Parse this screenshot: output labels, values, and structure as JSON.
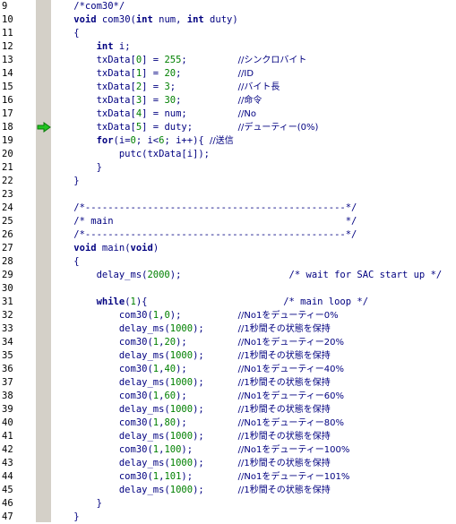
{
  "editor": {
    "current_line": 18,
    "lines": [
      {
        "n": 9,
        "seg": [
          {
            "t": "    /*com30*/",
            "c": "cm"
          }
        ]
      },
      {
        "n": 10,
        "seg": [
          {
            "t": "    ",
            "c": "pl"
          },
          {
            "t": "void",
            "c": "kw"
          },
          {
            "t": " com30(",
            "c": "pl"
          },
          {
            "t": "int",
            "c": "kw"
          },
          {
            "t": " num, ",
            "c": "pl"
          },
          {
            "t": "int",
            "c": "kw"
          },
          {
            "t": " duty)",
            "c": "pl"
          }
        ]
      },
      {
        "n": 11,
        "seg": [
          {
            "t": "    {",
            "c": "pl"
          }
        ]
      },
      {
        "n": 12,
        "seg": [
          {
            "t": "        ",
            "c": "pl"
          },
          {
            "t": "int",
            "c": "kw"
          },
          {
            "t": " i;",
            "c": "pl"
          }
        ]
      },
      {
        "n": 13,
        "seg": [
          {
            "t": "        txData[",
            "c": "pl"
          },
          {
            "t": "0",
            "c": "nm"
          },
          {
            "t": "] = ",
            "c": "pl"
          },
          {
            "t": "255",
            "c": "nm"
          },
          {
            "t": ";         ",
            "c": "pl"
          },
          {
            "t": "//シンクロバイト",
            "c": "cm jp"
          }
        ]
      },
      {
        "n": 14,
        "seg": [
          {
            "t": "        txData[",
            "c": "pl"
          },
          {
            "t": "1",
            "c": "nm"
          },
          {
            "t": "] = ",
            "c": "pl"
          },
          {
            "t": "20",
            "c": "nm"
          },
          {
            "t": ";          ",
            "c": "pl"
          },
          {
            "t": "//ID",
            "c": "cm jp"
          }
        ]
      },
      {
        "n": 15,
        "seg": [
          {
            "t": "        txData[",
            "c": "pl"
          },
          {
            "t": "2",
            "c": "nm"
          },
          {
            "t": "] = ",
            "c": "pl"
          },
          {
            "t": "3",
            "c": "nm"
          },
          {
            "t": ";           ",
            "c": "pl"
          },
          {
            "t": "//バイト長",
            "c": "cm jp"
          }
        ]
      },
      {
        "n": 16,
        "seg": [
          {
            "t": "        txData[",
            "c": "pl"
          },
          {
            "t": "3",
            "c": "nm"
          },
          {
            "t": "] = ",
            "c": "pl"
          },
          {
            "t": "30",
            "c": "nm"
          },
          {
            "t": ";          ",
            "c": "pl"
          },
          {
            "t": "//命令",
            "c": "cm jp"
          }
        ]
      },
      {
        "n": 17,
        "seg": [
          {
            "t": "        txData[",
            "c": "pl"
          },
          {
            "t": "4",
            "c": "nm"
          },
          {
            "t": "] = num;         ",
            "c": "pl"
          },
          {
            "t": "//No",
            "c": "cm jp"
          }
        ]
      },
      {
        "n": 18,
        "seg": [
          {
            "t": "        txData[",
            "c": "pl"
          },
          {
            "t": "5",
            "c": "nm"
          },
          {
            "t": "] = duty;        ",
            "c": "pl"
          },
          {
            "t": "//デューティー(0%)",
            "c": "cm jp"
          }
        ]
      },
      {
        "n": 19,
        "seg": [
          {
            "t": "        ",
            "c": "pl"
          },
          {
            "t": "for",
            "c": "kw"
          },
          {
            "t": "(i=",
            "c": "pl"
          },
          {
            "t": "0",
            "c": "nm"
          },
          {
            "t": "; i<",
            "c": "pl"
          },
          {
            "t": "6",
            "c": "nm"
          },
          {
            "t": "; i++){ ",
            "c": "pl"
          },
          {
            "t": "//送信",
            "c": "cm jp"
          }
        ]
      },
      {
        "n": 20,
        "seg": [
          {
            "t": "            putc(txData[i]);",
            "c": "pl"
          }
        ]
      },
      {
        "n": 21,
        "seg": [
          {
            "t": "        }",
            "c": "pl"
          }
        ]
      },
      {
        "n": 22,
        "seg": [
          {
            "t": "    }",
            "c": "pl"
          }
        ]
      },
      {
        "n": 23,
        "seg": [
          {
            "t": "",
            "c": "pl"
          }
        ]
      },
      {
        "n": 24,
        "seg": [
          {
            "t": "    /*----------------------------------------------*/",
            "c": "cm"
          }
        ]
      },
      {
        "n": 25,
        "seg": [
          {
            "t": "    /* main                                         */",
            "c": "cm"
          }
        ]
      },
      {
        "n": 26,
        "seg": [
          {
            "t": "    /*----------------------------------------------*/",
            "c": "cm"
          }
        ]
      },
      {
        "n": 27,
        "seg": [
          {
            "t": "    ",
            "c": "pl"
          },
          {
            "t": "void",
            "c": "kw"
          },
          {
            "t": " main(",
            "c": "pl"
          },
          {
            "t": "void",
            "c": "kw"
          },
          {
            "t": ")",
            "c": "pl"
          }
        ]
      },
      {
        "n": 28,
        "seg": [
          {
            "t": "    {",
            "c": "pl"
          }
        ]
      },
      {
        "n": 29,
        "seg": [
          {
            "t": "        delay_ms(",
            "c": "pl"
          },
          {
            "t": "2000",
            "c": "nm"
          },
          {
            "t": ");                   ",
            "c": "pl"
          },
          {
            "t": "/* wait for SAC start up */",
            "c": "cm"
          }
        ]
      },
      {
        "n": 30,
        "seg": [
          {
            "t": "",
            "c": "pl"
          }
        ]
      },
      {
        "n": 31,
        "seg": [
          {
            "t": "        ",
            "c": "pl"
          },
          {
            "t": "while",
            "c": "kw"
          },
          {
            "t": "(",
            "c": "pl"
          },
          {
            "t": "1",
            "c": "nm"
          },
          {
            "t": "){                        ",
            "c": "pl"
          },
          {
            "t": "/* main loop */",
            "c": "cm"
          }
        ]
      },
      {
        "n": 32,
        "seg": [
          {
            "t": "            com30(",
            "c": "pl"
          },
          {
            "t": "1",
            "c": "nm"
          },
          {
            "t": ",",
            "c": "pl"
          },
          {
            "t": "0",
            "c": "nm"
          },
          {
            "t": ");          ",
            "c": "pl"
          },
          {
            "t": "//No1をデューティー0%",
            "c": "cm jp"
          }
        ]
      },
      {
        "n": 33,
        "seg": [
          {
            "t": "            delay_ms(",
            "c": "pl"
          },
          {
            "t": "1000",
            "c": "nm"
          },
          {
            "t": ");      ",
            "c": "pl"
          },
          {
            "t": "//1秒間その状態を保持",
            "c": "cm jp"
          }
        ]
      },
      {
        "n": 34,
        "seg": [
          {
            "t": "            com30(",
            "c": "pl"
          },
          {
            "t": "1",
            "c": "nm"
          },
          {
            "t": ",",
            "c": "pl"
          },
          {
            "t": "20",
            "c": "nm"
          },
          {
            "t": ");         ",
            "c": "pl"
          },
          {
            "t": "//No1をデューティー20%",
            "c": "cm jp"
          }
        ]
      },
      {
        "n": 35,
        "seg": [
          {
            "t": "            delay_ms(",
            "c": "pl"
          },
          {
            "t": "1000",
            "c": "nm"
          },
          {
            "t": ");      ",
            "c": "pl"
          },
          {
            "t": "//1秒間その状態を保持",
            "c": "cm jp"
          }
        ]
      },
      {
        "n": 36,
        "seg": [
          {
            "t": "            com30(",
            "c": "pl"
          },
          {
            "t": "1",
            "c": "nm"
          },
          {
            "t": ",",
            "c": "pl"
          },
          {
            "t": "40",
            "c": "nm"
          },
          {
            "t": ");         ",
            "c": "pl"
          },
          {
            "t": "//No1をデューティー40%",
            "c": "cm jp"
          }
        ]
      },
      {
        "n": 37,
        "seg": [
          {
            "t": "            delay_ms(",
            "c": "pl"
          },
          {
            "t": "1000",
            "c": "nm"
          },
          {
            "t": ");      ",
            "c": "pl"
          },
          {
            "t": "//1秒間その状態を保持",
            "c": "cm jp"
          }
        ]
      },
      {
        "n": 38,
        "seg": [
          {
            "t": "            com30(",
            "c": "pl"
          },
          {
            "t": "1",
            "c": "nm"
          },
          {
            "t": ",",
            "c": "pl"
          },
          {
            "t": "60",
            "c": "nm"
          },
          {
            "t": ");         ",
            "c": "pl"
          },
          {
            "t": "//No1をデューティー60%",
            "c": "cm jp"
          }
        ]
      },
      {
        "n": 39,
        "seg": [
          {
            "t": "            delay_ms(",
            "c": "pl"
          },
          {
            "t": "1000",
            "c": "nm"
          },
          {
            "t": ");      ",
            "c": "pl"
          },
          {
            "t": "//1秒間その状態を保持",
            "c": "cm jp"
          }
        ]
      },
      {
        "n": 40,
        "seg": [
          {
            "t": "            com30(",
            "c": "pl"
          },
          {
            "t": "1",
            "c": "nm"
          },
          {
            "t": ",",
            "c": "pl"
          },
          {
            "t": "80",
            "c": "nm"
          },
          {
            "t": ");         ",
            "c": "pl"
          },
          {
            "t": "//No1をデューティー80%",
            "c": "cm jp"
          }
        ]
      },
      {
        "n": 41,
        "seg": [
          {
            "t": "            delay_ms(",
            "c": "pl"
          },
          {
            "t": "1000",
            "c": "nm"
          },
          {
            "t": ");      ",
            "c": "pl"
          },
          {
            "t": "//1秒間その状態を保持",
            "c": "cm jp"
          }
        ]
      },
      {
        "n": 42,
        "seg": [
          {
            "t": "            com30(",
            "c": "pl"
          },
          {
            "t": "1",
            "c": "nm"
          },
          {
            "t": ",",
            "c": "pl"
          },
          {
            "t": "100",
            "c": "nm"
          },
          {
            "t": ");        ",
            "c": "pl"
          },
          {
            "t": "//No1をデューティー100%",
            "c": "cm jp"
          }
        ]
      },
      {
        "n": 43,
        "seg": [
          {
            "t": "            delay_ms(",
            "c": "pl"
          },
          {
            "t": "1000",
            "c": "nm"
          },
          {
            "t": ");      ",
            "c": "pl"
          },
          {
            "t": "//1秒間その状態を保持",
            "c": "cm jp"
          }
        ]
      },
      {
        "n": 44,
        "seg": [
          {
            "t": "            com30(",
            "c": "pl"
          },
          {
            "t": "1",
            "c": "nm"
          },
          {
            "t": ",",
            "c": "pl"
          },
          {
            "t": "101",
            "c": "nm"
          },
          {
            "t": ");        ",
            "c": "pl"
          },
          {
            "t": "//No1をデューティー101%",
            "c": "cm jp"
          }
        ]
      },
      {
        "n": 45,
        "seg": [
          {
            "t": "            delay_ms(",
            "c": "pl"
          },
          {
            "t": "1000",
            "c": "nm"
          },
          {
            "t": ");      ",
            "c": "pl"
          },
          {
            "t": "//1秒間その状態を保持",
            "c": "cm jp"
          }
        ]
      },
      {
        "n": 46,
        "seg": [
          {
            "t": "        }",
            "c": "pl"
          }
        ]
      },
      {
        "n": 47,
        "seg": [
          {
            "t": "    }",
            "c": "pl"
          }
        ]
      }
    ]
  },
  "colors": {
    "keyword": "#000080",
    "comment": "#000080",
    "number": "#008000",
    "marker_bar": "#d4d0c8",
    "arrow": "#22c422"
  },
  "icons": {
    "current_line": "green-arrow-icon"
  }
}
